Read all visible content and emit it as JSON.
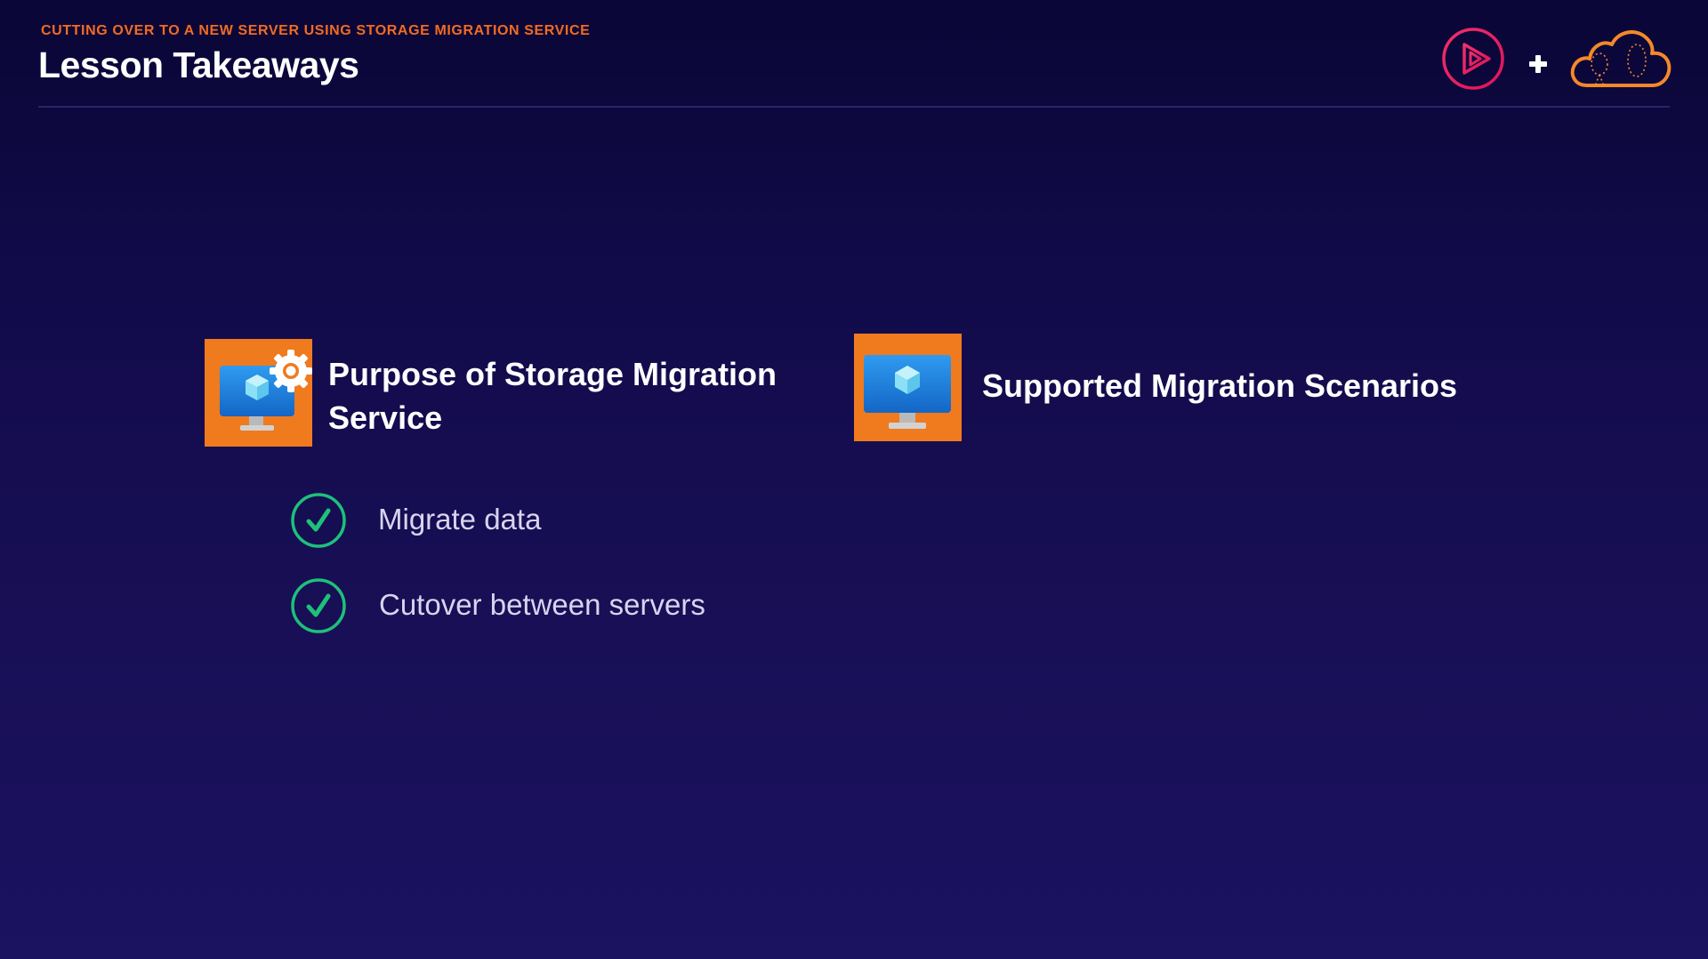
{
  "header": {
    "kicker": "CUTTING OVER TO A NEW SERVER USING STORAGE MIGRATION SERVICE",
    "title": "Lesson Takeaways",
    "brand": {
      "play_icon": "pluralsight-play-icon",
      "plus_glyph": "+",
      "cloud_icon": "a-cloud-guru-cloud-icon"
    }
  },
  "sections": [
    {
      "title_line1": "Purpose of Storage Migration",
      "title_line2": "Service",
      "icon": "vm-gear-icon",
      "items": [
        {
          "label": "Migrate data",
          "icon": "check-circle-icon"
        },
        {
          "label": "Cutover between servers",
          "icon": "check-circle-icon"
        }
      ]
    },
    {
      "title": "Supported Migration Scenarios",
      "icon": "vm-monitor-icon"
    }
  ],
  "colors": {
    "accent": "#f26b21",
    "tile": "#f07a1e",
    "check": "#1ec07a",
    "background_top": "#0a0636",
    "background_bottom": "#1b1260"
  }
}
